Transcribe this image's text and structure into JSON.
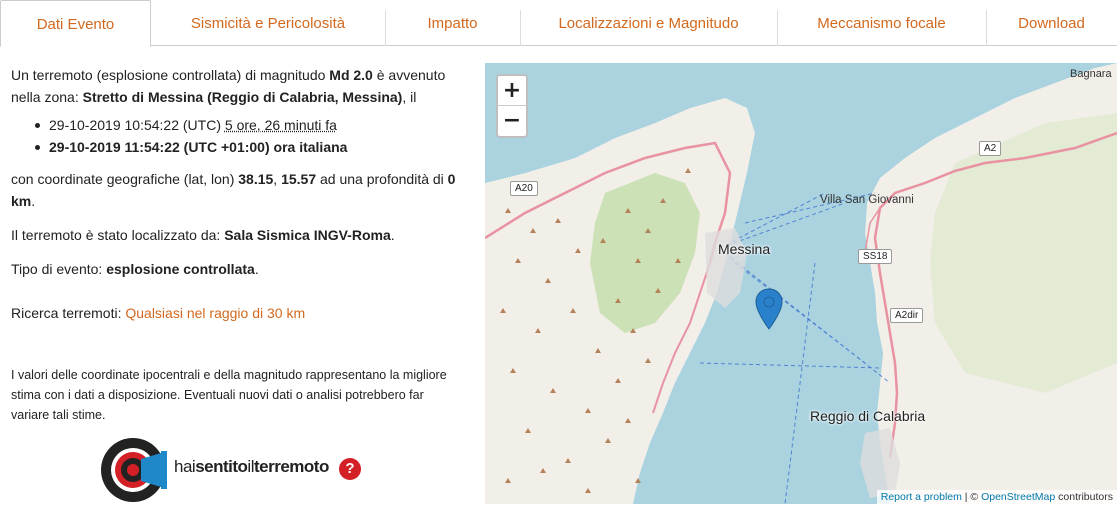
{
  "tabs": [
    {
      "label": "Dati Evento",
      "active": true
    },
    {
      "label": "Sismicità e Pericolosità",
      "active": false
    },
    {
      "label": "Impatto",
      "active": false
    },
    {
      "label": "Localizzazioni e Magnitudo",
      "active": false
    },
    {
      "label": "Meccanismo focale",
      "active": false
    },
    {
      "label": "Download",
      "active": false
    }
  ],
  "event": {
    "intro_pre": "Un terremoto (esplosione controllata) di magnitudo ",
    "magnitude": "Md 2.0",
    "intro_mid": " è avvenuto nella zona: ",
    "zone": "Stretto di Messina (Reggio di Calabria, Messina)",
    "intro_post": ", il",
    "time_utc": "29-10-2019 10:54:22 (UTC)",
    "time_ago": "5 ore, 26 minuti fa",
    "time_local": "29-10-2019 11:54:22 (UTC +01:00) ora italiana",
    "coords_pre": "con coordinate geografiche (lat, lon) ",
    "lat": "38.15",
    "lon": "15.57",
    "coords_mid": " ad una profondità di ",
    "depth": "0 km",
    "located_pre": "Il terremoto è stato localizzato da: ",
    "located_by": "Sala Sismica INGV-Roma",
    "type_pre": "Tipo di evento: ",
    "type": "esplosione controllata",
    "search_pre": "Ricerca terremoti: ",
    "search_link": "Qualsiasi nel raggio di 30 km",
    "note": "I valori delle coordinate ipocentrali e della magnitudo rappresentano la migliore stima con i dati a disposizione. Eventuali nuovi dati o analisi potrebbero far variare tali stime."
  },
  "logo": {
    "text_a": "hai",
    "text_b": "sentito",
    "text_c": "il",
    "text_d": "terremoto",
    "q": "?"
  },
  "map": {
    "zoom_in": "+",
    "zoom_out": "−",
    "labels": {
      "messina": "Messina",
      "reggio": "Reggio di Calabria",
      "villa": "Villa San Giovanni",
      "bagnara": "Bagnara",
      "a20": "A20",
      "a2": "A2",
      "ss18": "SS18",
      "a2dir": "A2dir"
    },
    "attribution_link1": "Report a problem",
    "attribution_sep": " | © ",
    "attribution_link2": "OpenStreetMap",
    "attribution_post": " contributors",
    "colors": {
      "sea": "#aad3df",
      "land": "#f2efe9",
      "forest": "#c8dfb0",
      "marker": "#2a81cb"
    }
  }
}
